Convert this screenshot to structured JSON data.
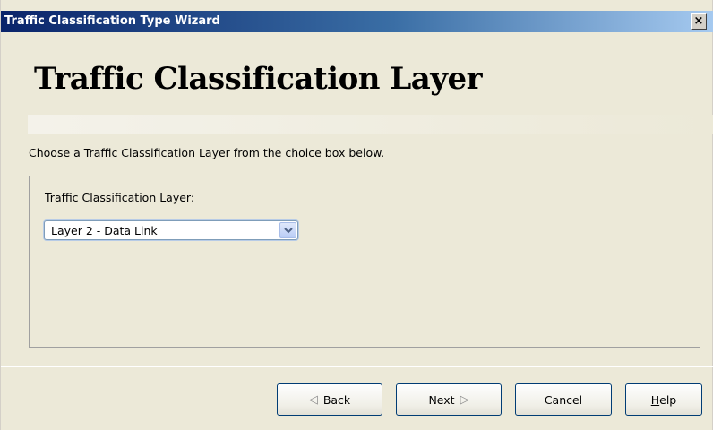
{
  "window": {
    "title": "Traffic Classification Type Wizard",
    "close_glyph": "×"
  },
  "main": {
    "heading": "Traffic Classification Layer",
    "instruction": "Choose a Traffic Classification Layer from the choice box below.",
    "field_label": "Traffic Classification Layer:",
    "select_value": "Layer 2 - Data Link"
  },
  "buttons": {
    "back": "Back",
    "next": "Next",
    "cancel": "Cancel",
    "help_first": "H",
    "help_rest": "elp"
  },
  "icons": {
    "back_arrow": "◁",
    "next_arrow": "▷",
    "select_arrow": "chevron-down-icon"
  }
}
